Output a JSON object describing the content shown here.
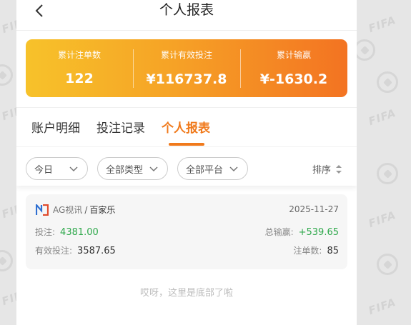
{
  "header": {
    "title": "个人报表"
  },
  "summary": {
    "bet_count_label": "累计注单数",
    "bet_count_value": "122",
    "valid_bet_label": "累计有效投注",
    "valid_bet_value": "¥116737.8",
    "win_loss_label": "累计输赢",
    "win_loss_value": "¥-1630.2"
  },
  "tabs": [
    {
      "label": "账户明细",
      "active": false
    },
    {
      "label": "投注记录",
      "active": false
    },
    {
      "label": "个人报表",
      "active": true
    }
  ],
  "filters": {
    "time": "今日",
    "type": "全部类型",
    "platform": "全部平台",
    "sort_label": "排序"
  },
  "records": [
    {
      "platform": "AG视讯",
      "separator": "/",
      "game": "百家乐",
      "date": "2025-11-27",
      "bet_label": "投注:",
      "bet_value": "4381.00",
      "win_loss_label": "总输赢:",
      "win_loss_value": "+539.65",
      "valid_bet_label": "有效投注:",
      "valid_bet_value": "3587.65",
      "count_label": "注单数:",
      "count_value": "85"
    }
  ],
  "footer": {
    "end_text": "哎呀，这里是底部了啦"
  },
  "background": {
    "watermark": "FIFA"
  },
  "colors": {
    "accent": "#f07a1c",
    "gradient_start": "#f7c22a",
    "gradient_end": "#f37322",
    "positive": "#2ea84b"
  }
}
